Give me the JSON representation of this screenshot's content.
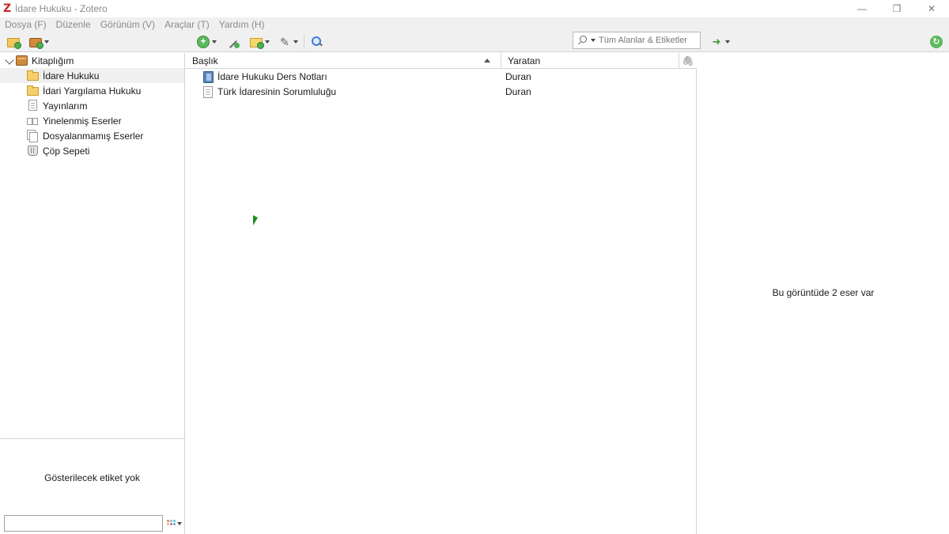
{
  "window": {
    "title": "İdare Hukuku - Zotero",
    "logo_glyph": "Z",
    "controls": {
      "minimize": "—",
      "restore": "❐",
      "close": "✕"
    }
  },
  "menu": {
    "items": [
      {
        "label": "Dosya (F)"
      },
      {
        "label": "Düzenle"
      },
      {
        "label": "Görünüm (V)"
      },
      {
        "label": "Araçlar (T)"
      },
      {
        "label": "Yardım (H)"
      }
    ]
  },
  "toolbar": {
    "icons": [
      "new-collection-icon",
      "new-library-icon",
      "new-item-icon",
      "add-by-identifier-icon",
      "new-note-icon",
      "add-attachment-icon",
      "advanced-search-icon",
      "locate-icon",
      "sync-icon"
    ],
    "search_placeholder": "Tüm Alanlar & Etiketler",
    "search_value": ""
  },
  "collections": {
    "library_label": "Kitaplığım",
    "items": [
      {
        "label": "İdare Hukuku",
        "icon": "folder-icon",
        "selected": true
      },
      {
        "label": "İdari Yargılama Hukuku",
        "icon": "folder-icon",
        "selected": false
      },
      {
        "label": "Yayınlarım",
        "icon": "document-icon",
        "selected": false
      },
      {
        "label": "Yinelenmiş Eserler",
        "icon": "duplicates-icon",
        "selected": false
      },
      {
        "label": "Dosyalanmamış Eserler",
        "icon": "unfiled-icon",
        "selected": false
      },
      {
        "label": "Çöp Sepeti",
        "icon": "trash-icon",
        "selected": false
      }
    ]
  },
  "tags": {
    "empty_message": "Gösterilecek etiket yok",
    "filter_value": ""
  },
  "items_table": {
    "columns": {
      "title": "Başlık",
      "creator": "Yaratan",
      "attachment_icon": "paperclip-icon"
    },
    "rows": [
      {
        "title": "İdare Hukuku Ders Notları",
        "creator": "Duran",
        "icon": "book-icon"
      },
      {
        "title": "Türk İdaresinin Sorumluluğu",
        "creator": "Duran",
        "icon": "document-icon"
      }
    ]
  },
  "item_pane": {
    "message": "Bu görüntüde 2 eser var"
  },
  "colors": {
    "logo": "#c62828",
    "folder": "#f6cf6a",
    "selection": "#f0f0f0",
    "accent_green": "#4caf50"
  }
}
